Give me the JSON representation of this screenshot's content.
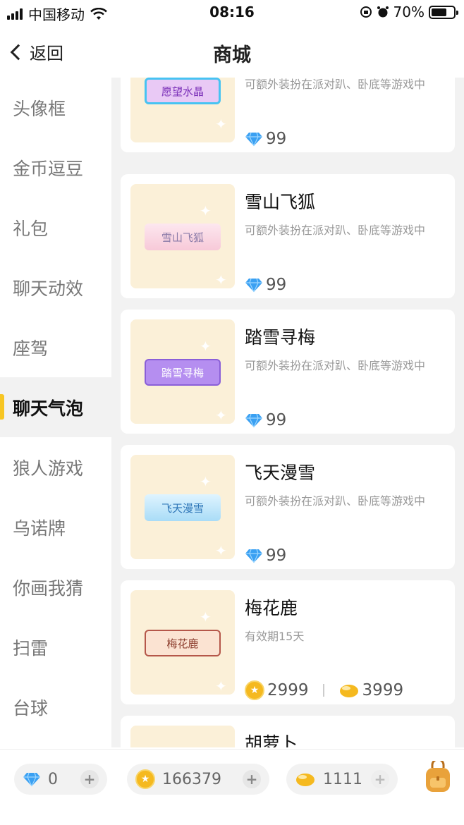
{
  "status_bar": {
    "carrier": "中国移动",
    "time": "08:16",
    "battery": "70%",
    "battery_level": 0.7
  },
  "nav": {
    "back_label": "返回",
    "title": "商城"
  },
  "sidebar": {
    "items": [
      {
        "label": "头像框"
      },
      {
        "label": "金币逗豆"
      },
      {
        "label": "礼包"
      },
      {
        "label": "聊天动效"
      },
      {
        "label": "座驾"
      },
      {
        "label": "聊天气泡",
        "active": true
      },
      {
        "label": "狼人游戏"
      },
      {
        "label": "乌诺牌"
      },
      {
        "label": "你画我猜"
      },
      {
        "label": "扫雷"
      },
      {
        "label": "台球"
      }
    ]
  },
  "products": [
    {
      "name": "",
      "badge": "愿望水晶",
      "desc": "可额外装扮在派对趴、卧底等游戏中",
      "price": "99"
    },
    {
      "name": "雪山飞狐",
      "badge": "雪山飞狐",
      "desc": "可额外装扮在派对趴、卧底等游戏中",
      "price": "99"
    },
    {
      "name": "踏雪寻梅",
      "badge": "踏雪寻梅",
      "desc": "可额外装扮在派对趴、卧底等游戏中",
      "price": "99"
    },
    {
      "name": "飞天漫雪",
      "badge": "飞天漫雪",
      "desc": "可额外装扮在派对趴、卧底等游戏中",
      "price": "99"
    },
    {
      "name": "梅花鹿",
      "badge": "梅花鹿",
      "desc": "有效期15天",
      "coin_price": "2999",
      "bean_price": "3999"
    },
    {
      "name": "胡萝卜"
    }
  ],
  "wallet": {
    "diamonds": "0",
    "coins": "166379",
    "beans": "1111"
  },
  "colors": {
    "accent": "#f7c623",
    "gem": "#3aa0f2",
    "coin": "#f5b91f"
  }
}
